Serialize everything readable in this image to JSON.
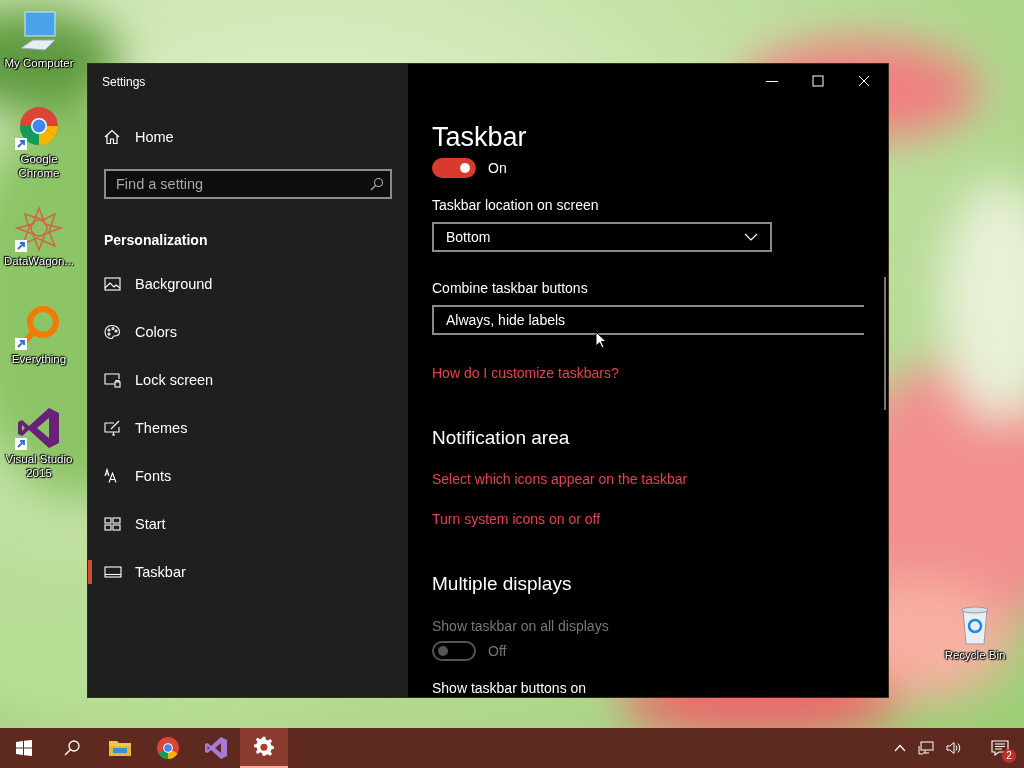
{
  "desktop_icons": [
    {
      "kind": "computer",
      "label": "My Computer",
      "shortcut": false
    },
    {
      "kind": "chrome",
      "label": "Google Chrome",
      "shortcut": true
    },
    {
      "kind": "datawagon",
      "label": "DataWagon...",
      "shortcut": true
    },
    {
      "kind": "everything",
      "label": "Everything",
      "shortcut": true
    },
    {
      "kind": "vstudio",
      "label": "Visual Studio 2015",
      "shortcut": true
    },
    {
      "kind": "recycle",
      "label": "Recycle Bin",
      "shortcut": false
    }
  ],
  "window": {
    "title": "Settings"
  },
  "sidebar": {
    "home": "Home",
    "search": {
      "placeholder": "Find a setting"
    },
    "section": "Personalization",
    "items": [
      {
        "label": "Background",
        "selected": false
      },
      {
        "label": "Colors",
        "selected": false
      },
      {
        "label": "Lock screen",
        "selected": false
      },
      {
        "label": "Themes",
        "selected": false
      },
      {
        "label": "Fonts",
        "selected": false
      },
      {
        "label": "Start",
        "selected": false
      },
      {
        "label": "Taskbar",
        "selected": true
      }
    ]
  },
  "content": {
    "title": "Taskbar",
    "blocks": [
      {
        "kind": "toggle",
        "on": true,
        "label": "On",
        "disabled": false
      },
      {
        "kind": "label",
        "text": "Taskbar location on screen",
        "disabled": false
      },
      {
        "kind": "dropdown",
        "value": "Bottom",
        "wide": false
      },
      {
        "kind": "label",
        "text": "Combine taskbar buttons",
        "disabled": false
      },
      {
        "kind": "dropdown",
        "value": "Always, hide labels",
        "wide": true
      },
      {
        "kind": "link",
        "text": "How do I customize taskbars?"
      },
      {
        "kind": "heading",
        "text": "Notification area"
      },
      {
        "kind": "link",
        "text": "Select which icons appear on the taskbar"
      },
      {
        "kind": "link",
        "text": "Turn system icons on or off"
      },
      {
        "kind": "heading",
        "text": "Multiple displays"
      },
      {
        "kind": "label",
        "text": "Show taskbar on all displays",
        "disabled": true
      },
      {
        "kind": "toggle",
        "on": false,
        "label": "Off",
        "disabled": true
      },
      {
        "kind": "label",
        "text": "Show taskbar buttons on",
        "disabled": false
      }
    ]
  },
  "taskbar": {
    "apps": [
      {
        "kind": "explorer",
        "selected": false
      },
      {
        "kind": "chrome",
        "selected": false
      },
      {
        "kind": "vstudio",
        "selected": false
      },
      {
        "kind": "settings",
        "selected": true
      }
    ],
    "notification_badge": "2"
  }
}
